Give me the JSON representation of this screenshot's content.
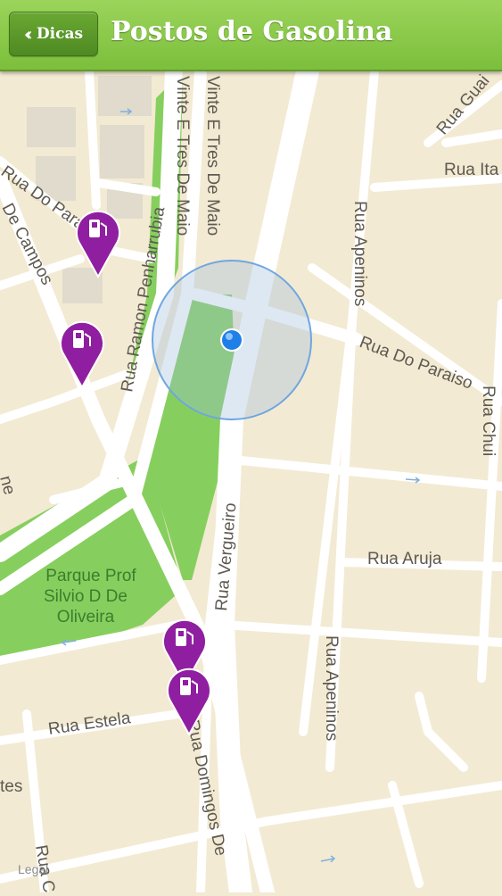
{
  "header": {
    "back_label": "Dicas",
    "back_icon": "double-chevron-left",
    "title": "Postos de Gasolina"
  },
  "colors": {
    "header_green": "#86c84a",
    "map_background": "#f3ead3",
    "park_green": "#86cf5e",
    "pin_purple": "#8f1fa0",
    "location_blue": "#1f7fe8"
  },
  "map": {
    "streets": {
      "vinte_e_tres_de_maio_1": "Vinte E Tres De Maio",
      "vinte_e_tres_de_maio_2": "Vinte E Tres De Maio",
      "vergueiro_top": "ergueiro",
      "rua_gual": "Rua Guai",
      "rua_ita": "Rua Ita",
      "rua_do_paraiso_left": "Rua Do Paraiso",
      "de_campos": "De Campos",
      "ramon_penharrubia": "Rua Ramon Penharrubia",
      "rua_apeninos_top": "Rua Apeninos",
      "rua_do_paraiso_right": "Rua Do Paraiso",
      "rua_chui": "Rua Chui",
      "rua_vergueiro": "Rua Vergueiro",
      "rua_aruja": "Rua Aruja",
      "rua_apeninos_bottom": "Rua Apeninos",
      "rua_estela": "Rua Estela",
      "rua_domingos_de": "Rua Domingos De",
      "tes": "tes",
      "rua_c": "Rua C",
      "ne": "ne"
    },
    "park_label_1": "Parque Prof",
    "park_label_2": "Silvio D De",
    "park_label_3": "Oliveira",
    "legal_label": "Legal",
    "pins": [
      {
        "icon": "fuel-pump-icon",
        "type": "gas-station"
      },
      {
        "icon": "fuel-pump-icon",
        "type": "gas-station"
      },
      {
        "icon": "fuel-pump-icon",
        "type": "gas-station"
      },
      {
        "icon": "fuel-pump-icon",
        "type": "gas-station"
      }
    ],
    "current_location": {
      "icon": "blue-dot"
    }
  }
}
